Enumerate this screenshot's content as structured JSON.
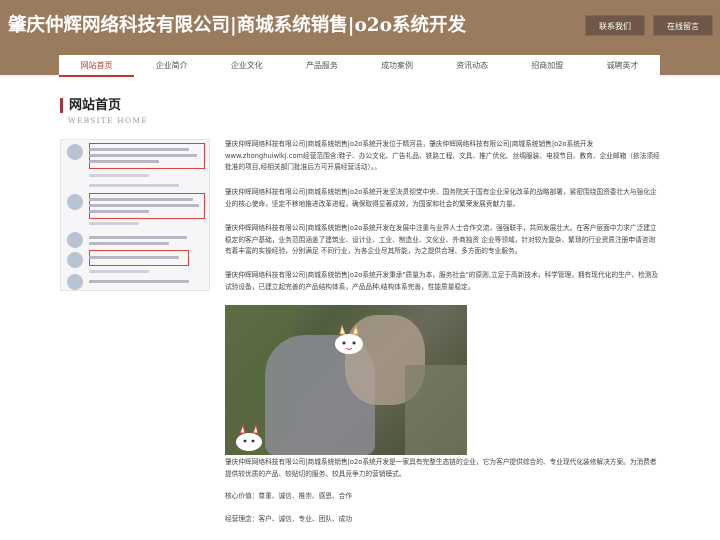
{
  "header": {
    "site_title": "肇庆仲辉网络科技有限公司|商城系统销售|o2o系统开发",
    "contact_button": "联系我们",
    "message_button": "在线留言"
  },
  "nav": {
    "items": [
      "网站首页",
      "企业简介",
      "企业文化",
      "产品服务",
      "成功案例",
      "资讯动态",
      "招商加盟",
      "诚聘英才"
    ]
  },
  "section": {
    "title": "网站首页",
    "subtitle": "WEBSITE HOME"
  },
  "paragraphs": [
    "肇庆仲辉网络科技有限公司|商城系统销售|o2o系统开发位于精河县，肇庆仲辉网络科技有限公司|商城系统销售|o2o系统开发www.zhonghuiwlkj.com经营范围含:鞋子、办公文化、广告礼品、铁路工程、文具、推广优化、丝绸服装、电视节目、教育、企业邮箱（依法须经批准的项目,经相关部门批准后方可开展经营活动）。。",
    "肇庆仲辉网络科技有限公司|商城系统销售|o2o系统开发坚决贯彻党中央、国务院关于国有企业深化改革的战略部署，紧密围绕国资委壮大与强化企业的核心使命，坚定不移地推进改革进程，确保取得显著成效，为国家和社会的繁荣发展贡献力量。",
    "肇庆仲辉网络科技有限公司|商城系统销售|o2o系统开发在发展中注重与业界人士合作交流，强强联手，共同发展壮大。在客户层面中力求广泛建立稳定的客户基础，业务范围涵盖了建筑业、设计业、工业、制造业、文化业、外商独资 企业等领域，针对较为复杂、繁琐的行业资质注册申请咨询有着丰富的实操经验，分别满足 不同行业，为各企业尽其所能，为之提供合理、多方面的专业服务。",
    "肇庆仲辉网络科技有限公司|商城系统销售|o2o系统开发秉承\"质量为本，服务社会\"的原则,立足于高新技术，科学管理，拥有现代化的生产、检测及试验设备，已建立起完善的产品结构体系，产品品种,结构体系完善，性能质量稳定。",
    "肇庆仲辉网络科技有限公司|商城系统销售|o2o系统开发是一家具有完整生态链的企业，它为客户提供综合的、专业现代化装修解决方案。为消费者提供较优质的产品、较贴切的服务、较具竞争力的营销模式。",
    "核心价值：尊重、诚信、推崇、感恩、合作",
    "经营理念：客户、诚信、专业、团队、成功"
  ],
  "colors": {
    "header_bg": "#9b7b5d",
    "accent": "#c0392b"
  }
}
